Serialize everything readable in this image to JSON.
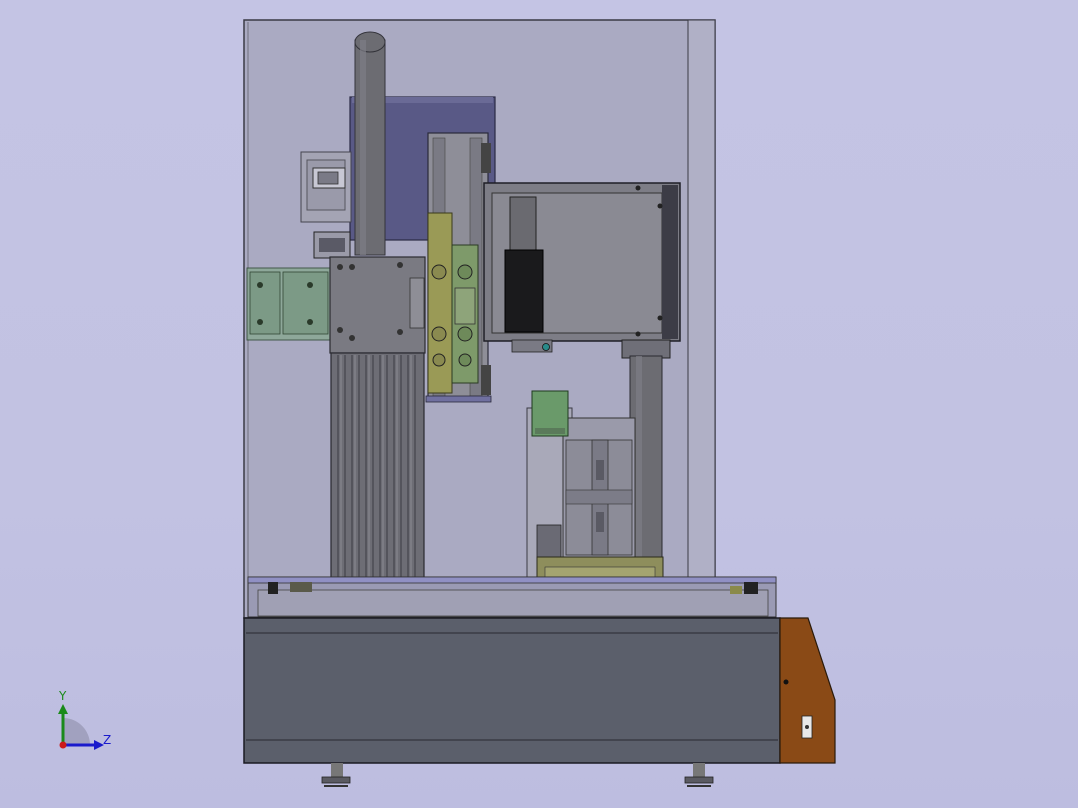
{
  "viewport": {
    "background_color": "#c3c3e3",
    "component": "machine-assembly-side-view"
  },
  "triad": {
    "y_label": "Y",
    "z_label": "Z",
    "colors": {
      "y_axis": "#1a8a1a",
      "z_axis": "#1a1acc",
      "x_axis": "#cc1a1a"
    }
  },
  "colors": {
    "enclosure": "#a9a9bf",
    "base": "#5a5e6a",
    "column": "#6b6b72",
    "carriage": "#55557a",
    "green_part": "#6a8a5a",
    "olive_part": "#8a8a4a",
    "side_panel": "#8a4a1a"
  }
}
